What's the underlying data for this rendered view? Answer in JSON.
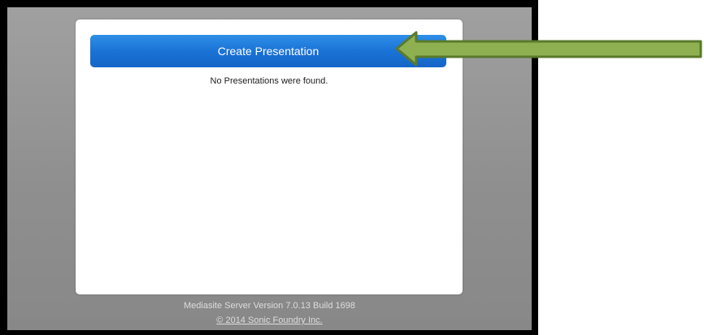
{
  "main": {
    "create_button_label": "Create Presentation",
    "empty_message": "No Presentations were found."
  },
  "footer": {
    "version": "Mediasite Server Version 7.0.13 Build 1698",
    "copyright": "© 2014 Sonic Foundry Inc."
  },
  "annotation": {
    "icon": "arrow-left-icon",
    "fill_color": "#8fb050",
    "stroke_color": "#5a7a2c"
  },
  "colors": {
    "button": "#1a73d6",
    "background": "#909090"
  }
}
